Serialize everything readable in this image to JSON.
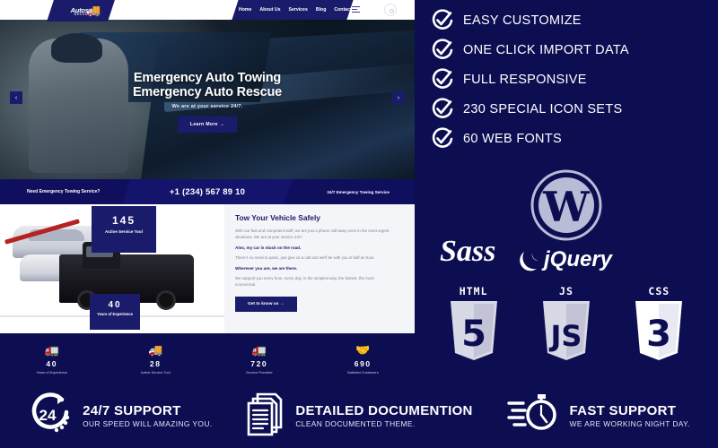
{
  "site": {
    "logo": {
      "name": "Autosup",
      "sub": "delivery",
      "icon": "tow-truck-icon"
    },
    "nav": [
      "Home",
      "About Us",
      "Services",
      "Blog",
      "Contact"
    ],
    "menu_icon": "hamburger-icon",
    "search_icon": "search-icon"
  },
  "hero": {
    "title_line1": "Emergency Auto Towing",
    "title_line2": "Emergency Auto Rescue",
    "subtitle": "We are at your service 24/7.",
    "button": "Learn More →",
    "prev_arrow": "‹",
    "next_arrow": "›"
  },
  "info_bar": {
    "left": "Need Emergency Towing Service?",
    "phone": "+1 (234) 567 89 10",
    "right": "24/7 Emergency Towing Service"
  },
  "about": {
    "badge_top": {
      "number": "145",
      "label": "Active Service Tool"
    },
    "badge_bottom": {
      "number": "40",
      "label": "Years of Experience"
    },
    "heading": "Tow Your Vehicle Safely",
    "p1": "With our fast and competent staff, we are just a phone call away even in the most urgent situations. We are at your service 24/7.",
    "s1": "Also, my car is stuck on the road.",
    "p2": "There's no need to panic, just give us a call and we'll be with you in half an hour.",
    "s2": "Wherever you are, we are there.",
    "p3": "We support you every hour, every day, in the simplest way, the fastest, the most economical.",
    "button": "Get to know us →"
  },
  "stats": [
    {
      "icon": "tow-truck-icon",
      "number": "40",
      "caption": "Years of Experience"
    },
    {
      "icon": "crane-truck-icon",
      "number": "28",
      "caption": "Active Service Tool"
    },
    {
      "icon": "flatbed-truck-icon",
      "number": "720",
      "caption": "Service Provided"
    },
    {
      "icon": "handshake-icon",
      "number": "690",
      "caption": "Satisfied Customers"
    }
  ],
  "features": [
    {
      "icon": "check-circle-icon",
      "label": "EASY CUSTOMIZE"
    },
    {
      "icon": "check-circle-icon",
      "label": "ONE CLICK IMPORT DATA"
    },
    {
      "icon": "check-circle-icon",
      "label": "FULL RESPONSIVE"
    },
    {
      "icon": "check-circle-icon",
      "label": "230 SPECIAL ICON SETS"
    },
    {
      "icon": "check-circle-icon",
      "label": "60 WEB FONTS"
    }
  ],
  "tech": {
    "wordpress": "wordpress-logo",
    "sass": "Sass",
    "jquery": "jQuery",
    "shields": [
      {
        "name": "HTML",
        "digit": "5",
        "color": "#d8d9e6"
      },
      {
        "name": "JS",
        "digit": "JS",
        "color": "#d8d9e6"
      },
      {
        "name": "CSS",
        "digit": "3",
        "color": "#ffffff"
      }
    ]
  },
  "bottom_bar": [
    {
      "icon": "clock-24-icon",
      "title": "24/7 SUPPORT",
      "subtitle": "OUR SPEED WILL AMAZING YOU."
    },
    {
      "icon": "documents-icon",
      "title": "DETAILED DOCUMENTION",
      "subtitle": "CLEAN DOCUMENTED THEME."
    },
    {
      "icon": "stopwatch-icon",
      "title": "FAST SUPPORT",
      "subtitle": "WE ARE WORKING NIGHT DAY."
    }
  ],
  "colors": {
    "brand_navy": "#1b1b6b",
    "panel_navy": "#0d0d52",
    "light_bg": "#f4f5f9"
  }
}
